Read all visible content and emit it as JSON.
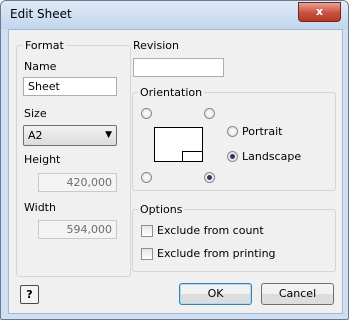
{
  "window": {
    "title": "Edit Sheet",
    "close_label": "x"
  },
  "format": {
    "legend": "Format",
    "name_label": "Name",
    "name_value": "Sheet",
    "size_label": "Size",
    "size_value": "A2",
    "height_label": "Height",
    "height_value": "420,000",
    "width_label": "Width",
    "width_value": "594,000"
  },
  "revision": {
    "label": "Revision",
    "value": ""
  },
  "orientation": {
    "legend": "Orientation",
    "portrait_label": "Portrait",
    "landscape_label": "Landscape",
    "selected": "Landscape"
  },
  "options": {
    "legend": "Options",
    "exclude_count_label": "Exclude from count",
    "exclude_printing_label": "Exclude from printing"
  },
  "buttons": {
    "help_label": "?",
    "ok_label": "OK",
    "cancel_label": "Cancel"
  },
  "colors": {
    "title_bar": "#c3d6ee",
    "close_button": "#c9513e",
    "client_bg": "#f0f0f0"
  },
  "icons": {
    "help": "question-mark-icon",
    "dropdown": "triangle-down-icon",
    "close": "close-icon"
  }
}
